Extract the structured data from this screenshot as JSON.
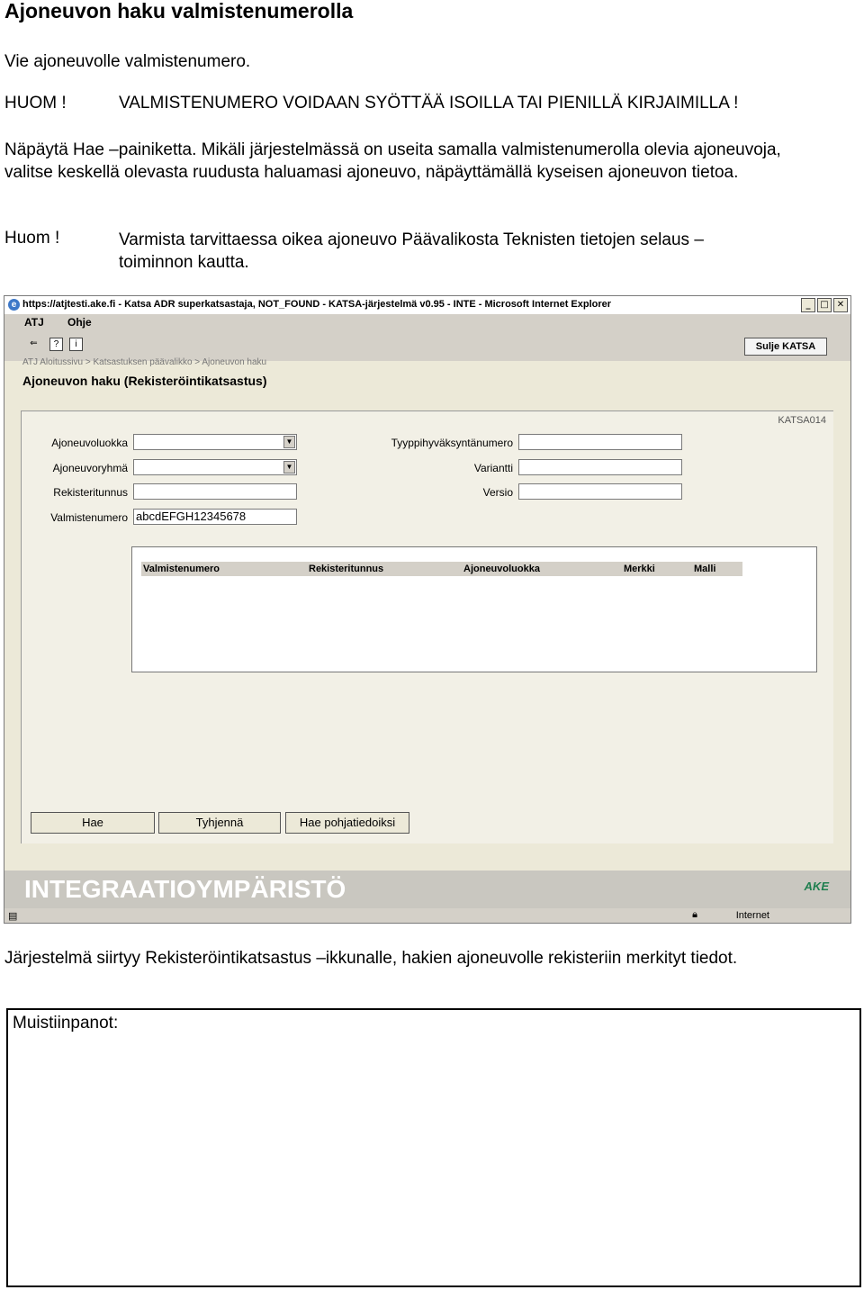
{
  "doc": {
    "heading": "Ajoneuvon haku valmistenumerolla",
    "intro": "Vie ajoneuvolle valmistenumero.",
    "huom_label": "HUOM !",
    "huom_text": "VALMISTENUMERO VOIDAAN SYÖTTÄÄ ISOILLA TAI PIENILLÄ KIRJAIMILLA !",
    "instruction": "Näpäytä Hae –painiketta. Mikäli järjestelmässä on useita samalla valmistenumerolla olevia ajoneuvoja, valitse keskellä olevasta ruudusta haluamasi ajoneuvo, näpäyttämällä kyseisen ajoneuvon tietoa.",
    "huom2_label": "Huom !",
    "huom2_text": "Varmista tarvittaessa oikea ajoneuvo Päävalikosta Teknisten tietojen selaus –toiminnon kautta.",
    "after": "Järjestelmä siirtyy Rekisteröintikatsastus –ikkunalle, hakien ajoneuvolle rekisteriin merkityt tiedot.",
    "notes_label": "Muistiinpanot:"
  },
  "screenshot": {
    "window_title": "https://atjtesti.ake.fi - Katsa ADR superkatsastaja, NOT_FOUND - KATSA-järjestelmä v0.95 - INTE - Microsoft Internet Explorer",
    "menu": [
      "ATJ",
      "Ohje"
    ],
    "toolbar_icons": [
      "back-icon",
      "help-icon",
      "info-icon"
    ],
    "close_button": "Sulje KATSA",
    "breadcrumb": "ATJ Aloitussivu > Katsastuksen päävalikko > Ajoneuvon haku",
    "page_title": "Ajoneuvon haku (Rekisteröintikatsastus)",
    "form_code": "KATSA014",
    "fields": {
      "ajoneuvoluokka": {
        "label": "Ajoneuvoluokka",
        "value": ""
      },
      "ajoneuvoryhma": {
        "label": "Ajoneuvoryhmä",
        "value": ""
      },
      "rekisteritunnus": {
        "label": "Rekisteritunnus",
        "value": ""
      },
      "valmistenumero": {
        "label": "Valmistenumero",
        "value": "abcdEFGH12345678"
      },
      "tyyppihyvaksynta": {
        "label": "Tyyppihyväksyntänumero",
        "value": ""
      },
      "variantti": {
        "label": "Variantti",
        "value": ""
      },
      "versio": {
        "label": "Versio",
        "value": ""
      }
    },
    "results_columns": [
      "Valmistenumero",
      "Rekisteritunnus",
      "Ajoneuvoluokka",
      "Merkki",
      "Malli"
    ],
    "buttons": {
      "hae": "Hae",
      "tyhjenna": "Tyhjennä",
      "pohjatiedot": "Hae pohjatiedoiksi"
    },
    "environment": "INTEGRAATIOYMPÄRISTÖ",
    "logo": "AKE",
    "status_zone": "Internet"
  }
}
